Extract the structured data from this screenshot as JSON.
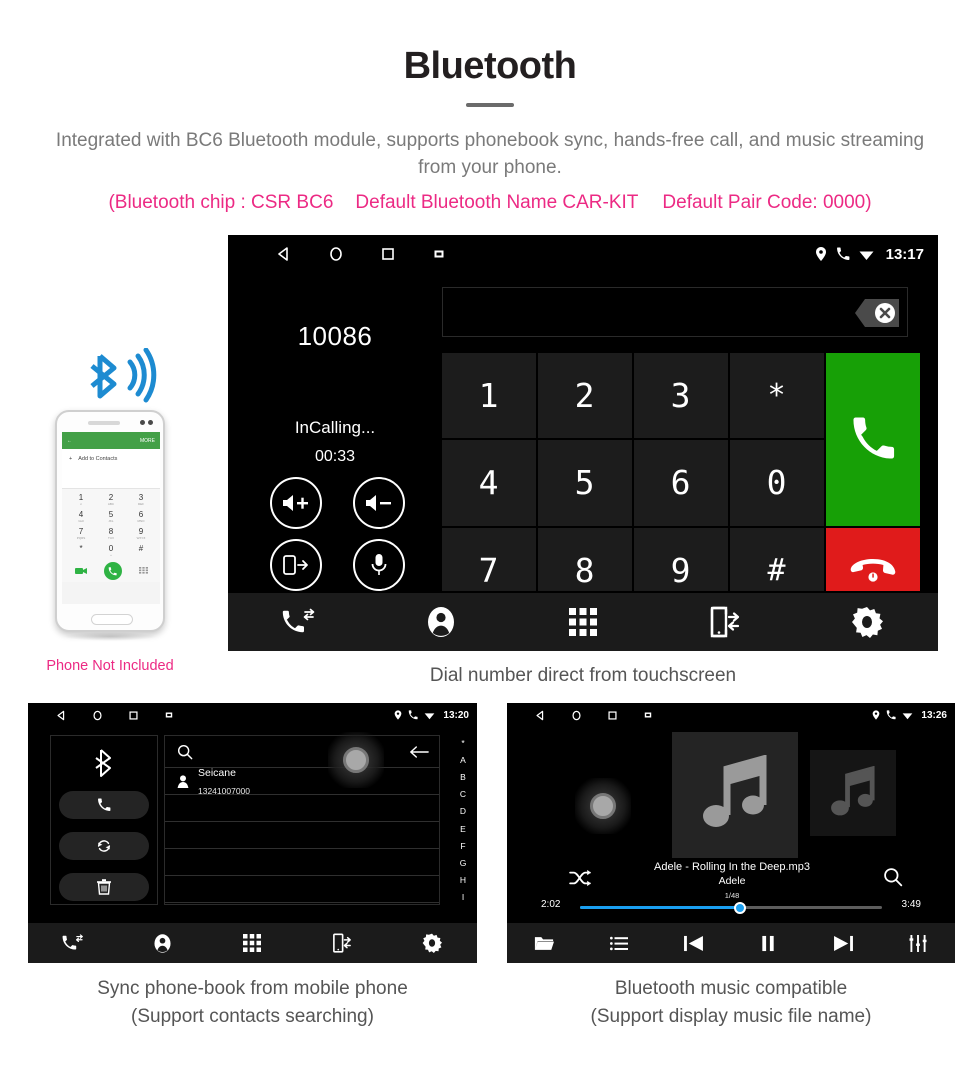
{
  "header": {
    "title": "Bluetooth",
    "subtitle": "Integrated with BC6 Bluetooth module, supports phonebook sync, hands-free call, and music streaming from your phone.",
    "spec_open": "(Bluetooth chip : CSR BC6",
    "spec_name": "Default Bluetooth Name CAR-KIT",
    "spec_pair": "Default Pair Code: 0000)",
    "pink_color": "#ec2a84",
    "subtitle_color": "#7a7a7a"
  },
  "phone_mock": {
    "note": "Phone Not Included",
    "bar_back": "←",
    "bar_more": "MORE",
    "add_label": "Add to Contacts",
    "plus": "+",
    "keys": [
      {
        "num": "1",
        "sub": "∞"
      },
      {
        "num": "2",
        "sub": "ABC"
      },
      {
        "num": "3",
        "sub": "DEF"
      },
      {
        "num": "4",
        "sub": "GHI"
      },
      {
        "num": "5",
        "sub": "JKL"
      },
      {
        "num": "6",
        "sub": "MNO"
      },
      {
        "num": "7",
        "sub": "PQRS"
      },
      {
        "num": "8",
        "sub": "TUV"
      },
      {
        "num": "9",
        "sub": "WXYZ"
      },
      {
        "num": "*",
        "sub": ""
      },
      {
        "num": "0",
        "sub": "+"
      },
      {
        "num": "#",
        "sub": ""
      }
    ]
  },
  "main_screen": {
    "statusbar": {
      "time": "13:17",
      "nav_icons": [
        "back-icon",
        "home-icon",
        "recents-icon",
        "screenshot-icon"
      ],
      "status_icons": [
        "location-icon",
        "phone-icon",
        "wifi-icon"
      ]
    },
    "call": {
      "number": "10086",
      "status": "InCalling...",
      "timer": "00:33",
      "buttons": [
        "volume-up-icon",
        "volume-down-icon",
        "transfer-to-phone-icon",
        "mute-mic-icon"
      ]
    },
    "dial_entry_value": "",
    "backspace_icon": "backspace-icon",
    "keypad": [
      "1",
      "2",
      "3",
      "*",
      "4",
      "5",
      "6",
      "0",
      "7",
      "8",
      "9",
      "#"
    ],
    "call_button": "call-icon",
    "end_button": "end-call-icon",
    "call_color": "#17a006",
    "end_color": "#e01b1b",
    "bottom_nav": [
      "call-log-icon",
      "contacts-icon",
      "dialpad-icon",
      "phone-sync-icon",
      "settings-gear-icon"
    ]
  },
  "captions": {
    "main": "Dial number direct from touchscreen",
    "phonebook_l1": "Sync phone-book from mobile phone",
    "phonebook_l2": "(Support contacts searching)",
    "music_l1": "Bluetooth music compatible",
    "music_l2": "(Support display music file name)"
  },
  "phonebook_screen": {
    "statusbar": {
      "time": "13:20"
    },
    "side_buttons": [
      "bluetooth-icon",
      "call-icon",
      "sync-icon",
      "delete-icon"
    ],
    "search_placeholder": "",
    "search_icon": "search-icon",
    "back_icon": "back-arrow-icon",
    "contact": {
      "name": "Seicane",
      "number": "13241007000"
    },
    "empty_rows": 4,
    "alpha_index": [
      "*",
      "A",
      "B",
      "C",
      "D",
      "E",
      "F",
      "G",
      "H",
      "I"
    ],
    "bottom_nav": [
      "call-log-icon",
      "contacts-icon",
      "dialpad-icon",
      "phone-sync-icon",
      "settings-gear-icon"
    ]
  },
  "music_screen": {
    "statusbar": {
      "time": "13:26"
    },
    "title": "Adele - Rolling In the Deep.mp3",
    "artist": "Adele",
    "track_count": "1/48",
    "elapsed": "2:02",
    "duration": "3:49",
    "progress_percent": 53,
    "progress_color": "#1a9ff0",
    "shuffle_icon": "shuffle-icon",
    "search_icon": "search-icon",
    "bottom_nav": [
      "folder-icon",
      "playlist-icon",
      "previous-icon",
      "pause-icon",
      "next-icon",
      "equalizer-icon"
    ]
  }
}
